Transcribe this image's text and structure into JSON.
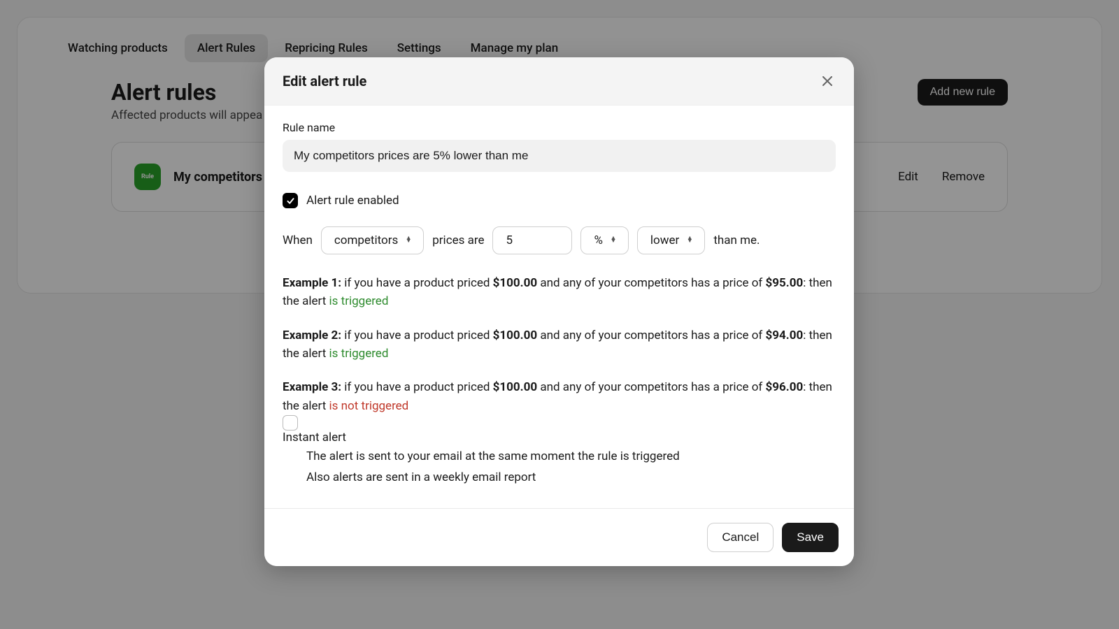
{
  "nav": {
    "tabs": [
      {
        "label": "Watching products"
      },
      {
        "label": "Alert Rules"
      },
      {
        "label": "Repricing Rules"
      },
      {
        "label": "Settings"
      },
      {
        "label": "Manage my plan"
      }
    ],
    "active_index": 1
  },
  "page": {
    "title": "Alert rules",
    "subtitle_visible": "Affected products will appea",
    "add_button": "Add new rule"
  },
  "rule_card": {
    "icon_label": "Rule",
    "name_visible": "My competitors",
    "edit_label": "Edit",
    "remove_label": "Remove"
  },
  "modal": {
    "title": "Edit alert rule",
    "rule_name_label": "Rule name",
    "rule_name_value": "My competitors prices are 5% lower than me",
    "enabled_checked": true,
    "enabled_label": "Alert rule enabled",
    "cond": {
      "when": "When",
      "who": "competitors",
      "prices_are": "prices are",
      "value": "5",
      "unit": "%",
      "direction": "lower",
      "than_me": "than me."
    },
    "examples": [
      {
        "title": "Example 1:",
        "text_a": " if you have a product priced ",
        "price_a": "$100.00",
        "text_b": " and any of your competitors has a price of ",
        "price_b": "$95.00",
        "text_c": ": then the alert ",
        "result": "is triggered",
        "result_class": "trig-yes"
      },
      {
        "title": "Example 2:",
        "text_a": " if you have a product priced ",
        "price_a": "$100.00",
        "text_b": " and any of your competitors has a price of ",
        "price_b": "$94.00",
        "text_c": ": then the alert ",
        "result": "is triggered",
        "result_class": "trig-yes"
      },
      {
        "title": "Example 3:",
        "text_a": " if you have a product priced ",
        "price_a": "$100.00",
        "text_b": " and any of your competitors has a price of ",
        "price_b": "$96.00",
        "text_c": ": then the alert ",
        "result": "is not triggered",
        "result_class": "trig-no"
      }
    ],
    "instant": {
      "checked": false,
      "label": "Instant alert",
      "desc1": "The alert is sent to your email at the same moment the rule is triggered",
      "desc2": "Also alerts are sent in a weekly email report"
    },
    "cancel": "Cancel",
    "save": "Save"
  }
}
